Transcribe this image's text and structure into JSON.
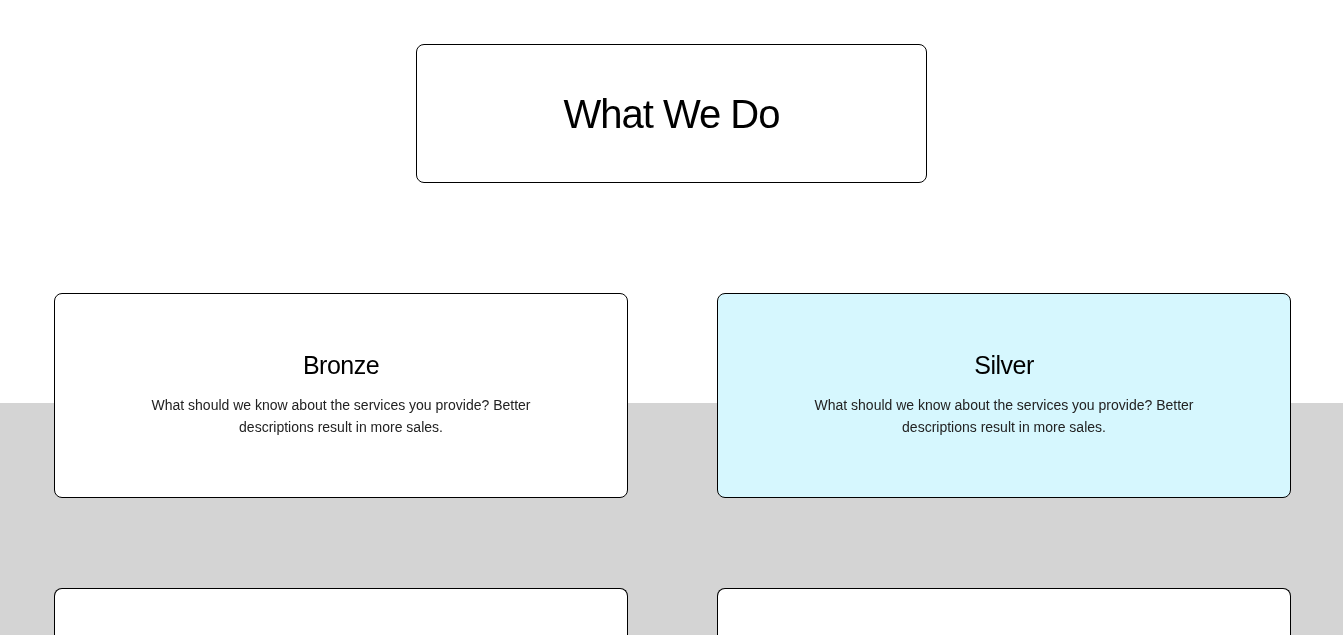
{
  "heading": {
    "title": "What We Do"
  },
  "services": [
    {
      "title": "Bronze",
      "description": "What should we know about the services you provide? Better descriptions result in more sales.",
      "highlighted": false
    },
    {
      "title": "Silver",
      "description": "What should we know about the services you provide? Better descriptions result in more sales.",
      "highlighted": true
    },
    {
      "highlighted": false
    },
    {
      "highlighted": false
    }
  ]
}
